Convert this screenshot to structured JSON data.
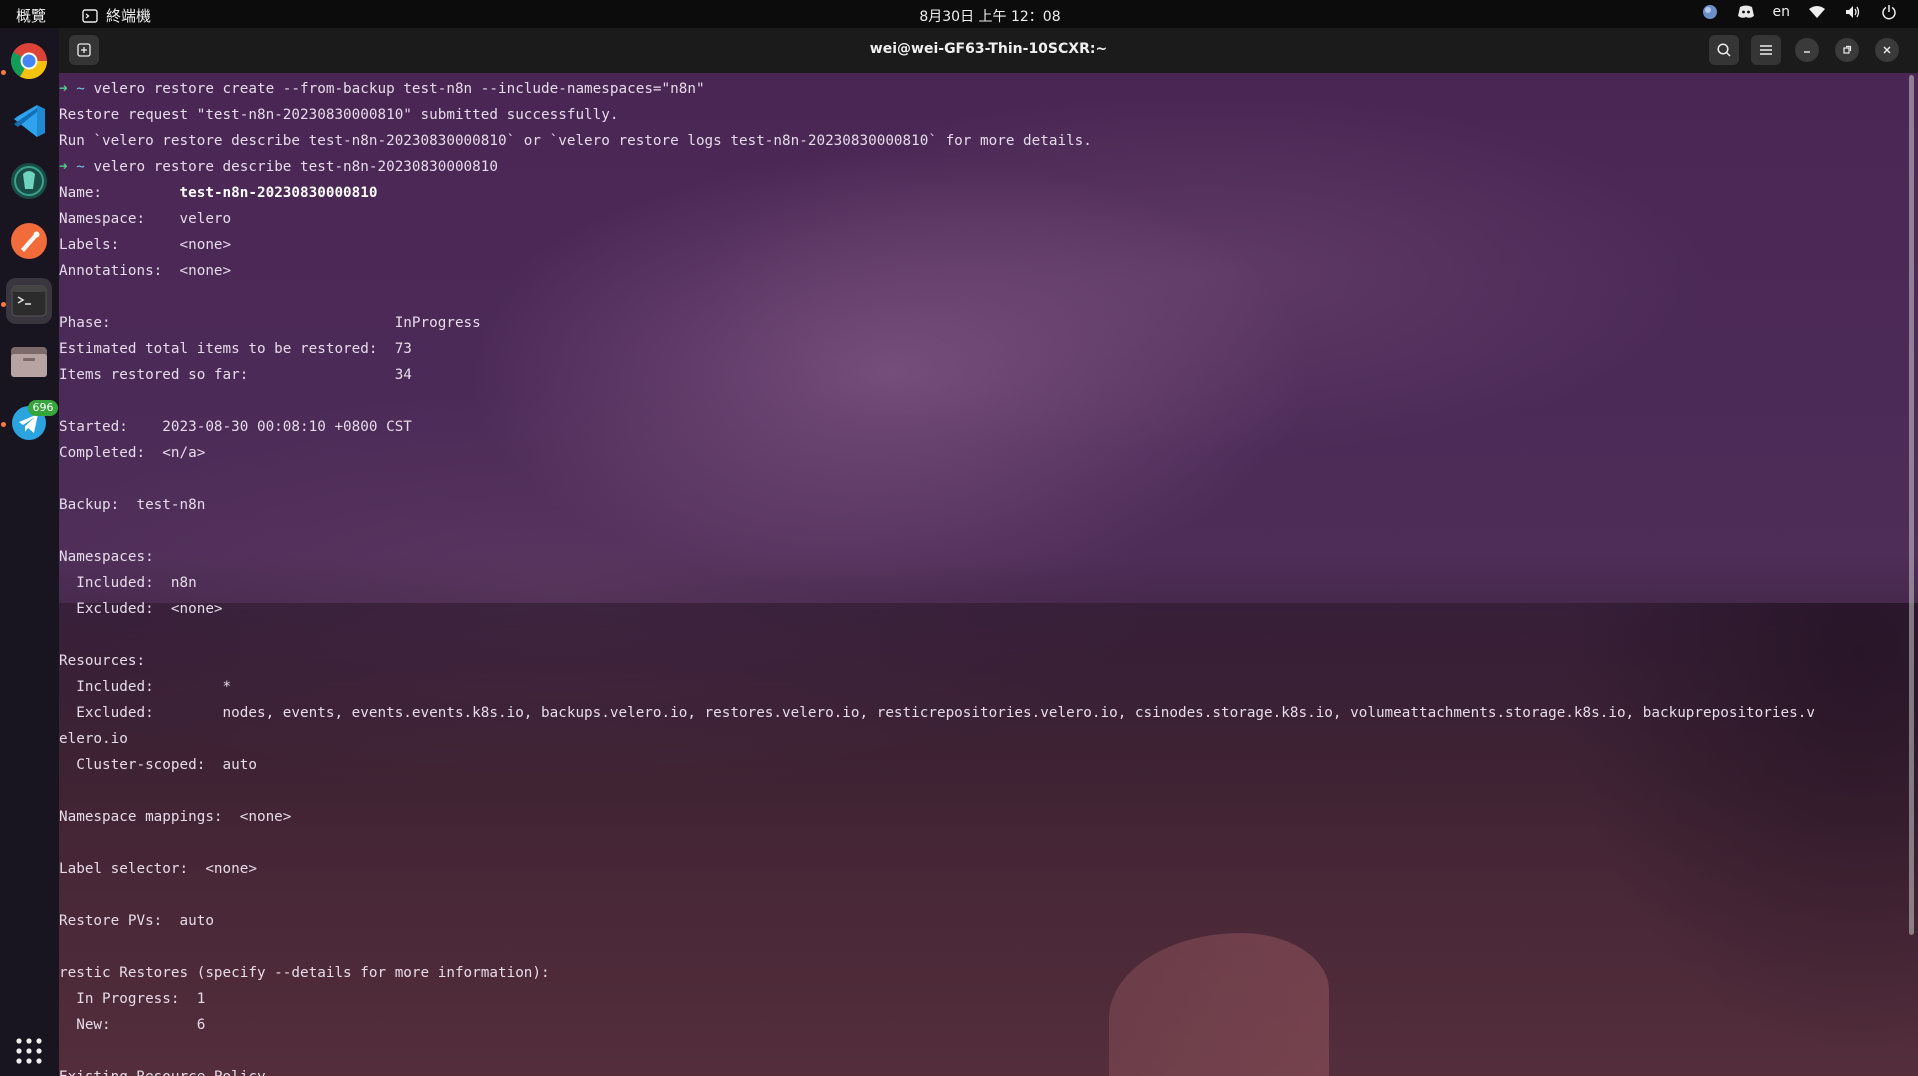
{
  "topbar": {
    "activities": "概覽",
    "app_name": "終端機",
    "clock": "8月30日 上午 12：08",
    "language": "en"
  },
  "dock": {
    "items": [
      {
        "name": "chrome-icon"
      },
      {
        "name": "vscode-icon"
      },
      {
        "name": "gitkraken-icon"
      },
      {
        "name": "postman-icon"
      },
      {
        "name": "terminal-icon"
      },
      {
        "name": "files-icon"
      },
      {
        "name": "telegram-icon",
        "badge": "696"
      },
      {
        "name": "app-grid-icon"
      }
    ]
  },
  "window": {
    "title": "wei@wei-GF63-Thin-10SCXR:~"
  },
  "terminal": {
    "prompt_arrow": "➜",
    "prompt_tilde": "~",
    "lines": [
      {
        "prompt": true,
        "text": "velero restore create --from-backup test-n8n --include-namespaces=\"n8n\""
      },
      {
        "text": "Restore request \"test-n8n-20230830000810\" submitted successfully."
      },
      {
        "text": "Run `velero restore describe test-n8n-20230830000810` or `velero restore logs test-n8n-20230830000810` for more details."
      },
      {
        "prompt": true,
        "text": "velero restore describe test-n8n-20230830000810"
      },
      {
        "label": "Name:         ",
        "bold": "test-n8n-20230830000810"
      },
      {
        "text": "Namespace:    velero"
      },
      {
        "text": "Labels:       <none>"
      },
      {
        "text": "Annotations:  <none>"
      },
      {
        "text": ""
      },
      {
        "text": "Phase:                                 InProgress"
      },
      {
        "text": "Estimated total items to be restored:  73"
      },
      {
        "text": "Items restored so far:                 34"
      },
      {
        "text": ""
      },
      {
        "text": "Started:    2023-08-30 00:08:10 +0800 CST"
      },
      {
        "text": "Completed:  <n/a>"
      },
      {
        "text": ""
      },
      {
        "text": "Backup:  test-n8n"
      },
      {
        "text": ""
      },
      {
        "text": "Namespaces:"
      },
      {
        "text": "  Included:  n8n"
      },
      {
        "text": "  Excluded:  <none>"
      },
      {
        "text": ""
      },
      {
        "text": "Resources:"
      },
      {
        "text": "  Included:        *"
      },
      {
        "text": "  Excluded:        nodes, events, events.events.k8s.io, backups.velero.io, restores.velero.io, resticrepositories.velero.io, csinodes.storage.k8s.io, volumeattachments.storage.k8s.io, backuprepositories.v"
      },
      {
        "text": "elero.io"
      },
      {
        "text": "  Cluster-scoped:  auto"
      },
      {
        "text": ""
      },
      {
        "text": "Namespace mappings:  <none>"
      },
      {
        "text": ""
      },
      {
        "text": "Label selector:  <none>"
      },
      {
        "text": ""
      },
      {
        "text": "Restore PVs:  auto"
      },
      {
        "text": ""
      },
      {
        "text": "restic Restores (specify --details for more information):"
      },
      {
        "text": "  In Progress:  1"
      },
      {
        "text": "  New:          6"
      },
      {
        "text": ""
      },
      {
        "text": "Existing Resource Policy"
      }
    ]
  }
}
